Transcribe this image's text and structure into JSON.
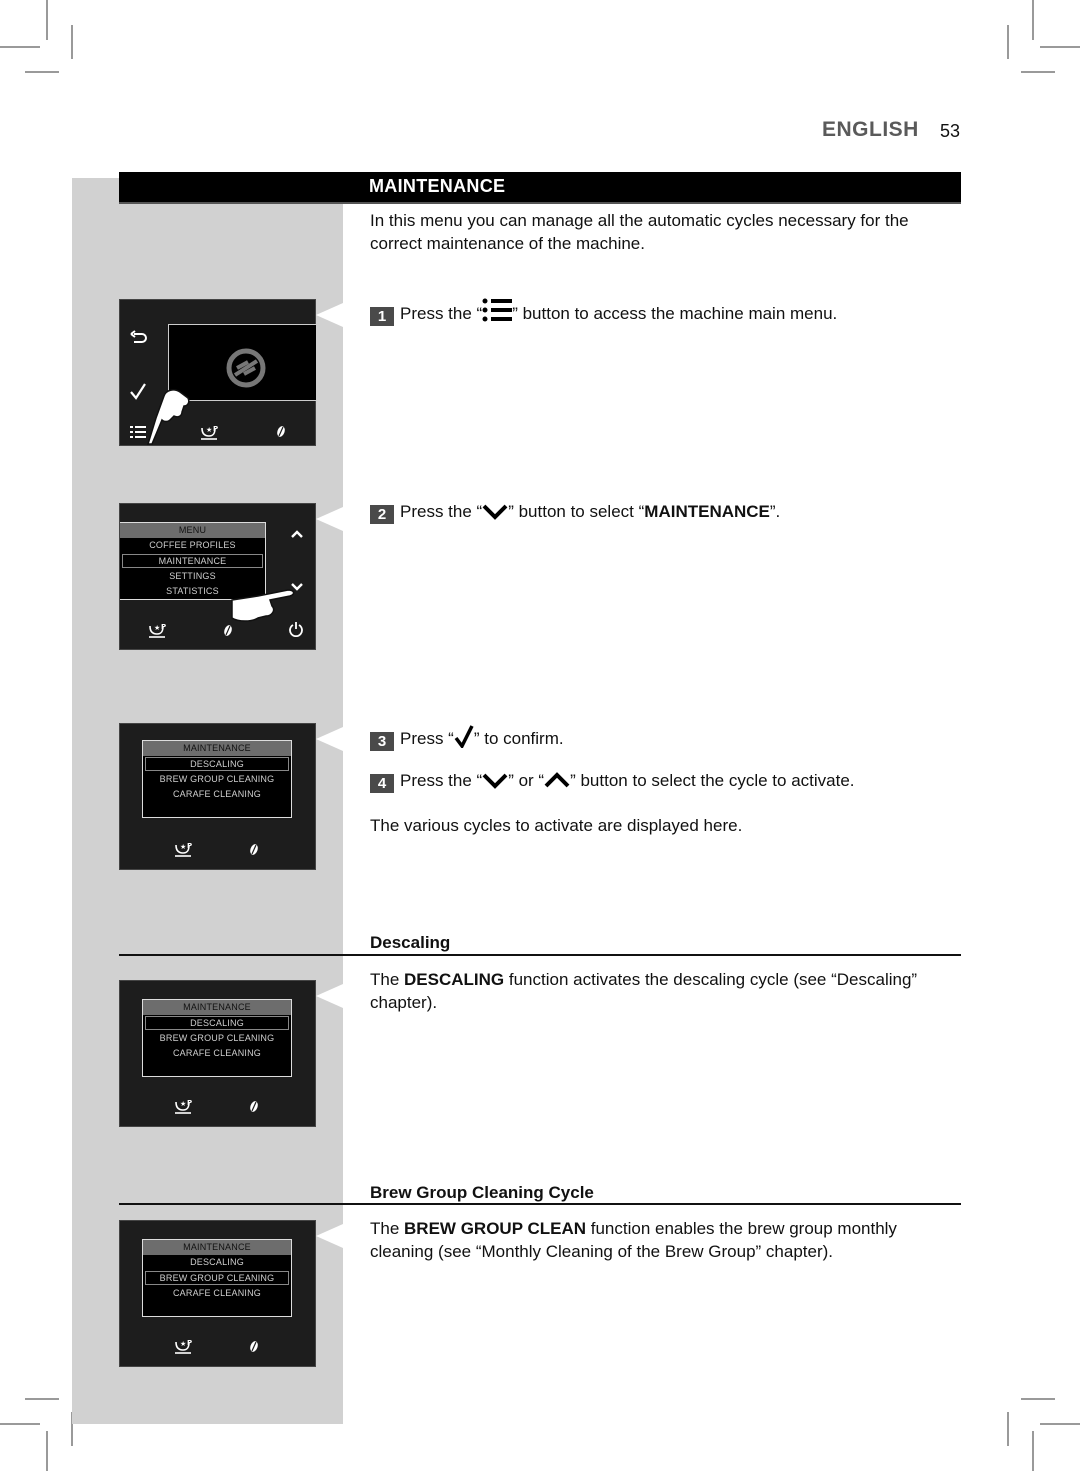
{
  "header": {
    "language": "ENGLISH",
    "page_number": "53"
  },
  "section_title": "MAINTENANCE",
  "intro": "In this menu you can manage all the automatic cycles necessary for the correct maintenance of the machine.",
  "steps": [
    {
      "num": "1",
      "before": "Press the “",
      "icon": "menu-list-icon",
      "after": "” button to access the machine main menu."
    },
    {
      "num": "2",
      "before": "Press the “",
      "icon": "chevron-down-icon",
      "mid": "” button to select “",
      "bold": "MAINTENANCE",
      "after": "”."
    },
    {
      "num": "3",
      "before": "Press “",
      "icon": "check-icon",
      "after": "” to confirm."
    },
    {
      "num": "4",
      "before": "Press the “",
      "icon": "chevron-down-icon",
      "mid": "” or “",
      "icon2": "chevron-up-icon",
      "after": "” button to select the cycle to activate."
    }
  ],
  "cycles_note": "The various cycles to activate are displayed here.",
  "descaling": {
    "heading": "Descaling",
    "before": "The ",
    "bold": "DESCALING",
    "after": " function activates the descaling cycle (see “Descaling” chapter)."
  },
  "brew_group": {
    "heading": "Brew Group Cleaning Cycle",
    "before": "The ",
    "bold": "BREW GROUP CLEAN",
    "after": " function enables the brew group monthly cleaning (see “Monthly Cleaning of the Brew Group” chapter)."
  },
  "panels": {
    "main_menu": {
      "title": "MENU",
      "items": [
        "COFFEE PROFILES",
        "MAINTENANCE",
        "SETTINGS",
        "STATISTICS"
      ],
      "selected": "MAINTENANCE"
    },
    "maintenance_menu": {
      "title": "MAINTENANCE",
      "items": [
        "DESCALING",
        "BREW GROUP CLEANING",
        "CARAFE CLEANING"
      ]
    }
  },
  "colors": {
    "title_bar": "#000000",
    "side_column": "#d1d1d1",
    "panel": "#1d1d1d",
    "menu_header": "#6d6d6d",
    "language_label": "#5a5a5a"
  }
}
